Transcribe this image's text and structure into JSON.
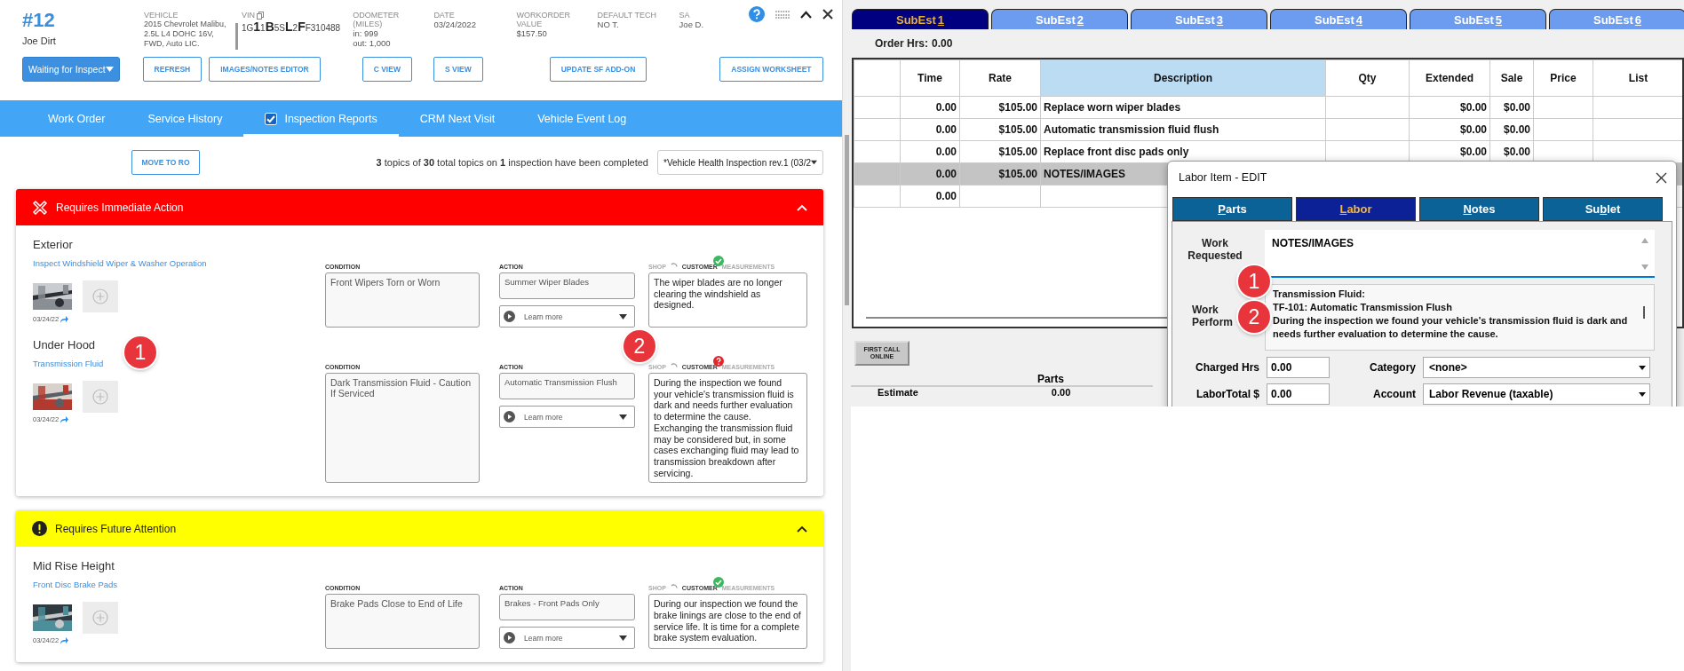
{
  "work_order": {
    "number": "#12",
    "customer": "Joe Dirt",
    "info": [
      {
        "kind": "text",
        "label": "VEHICLE",
        "lines": [
          "2015 Chevrolet Malibu, 2.5L L4 DOHC 16V, FWD, Auto LIC."
        ]
      },
      {
        "kind": "vin",
        "label": "VIN",
        "vin": "1G**1**1**B**5S**L**2**F**F310488"
      },
      {
        "kind": "text",
        "label": "ODOMETER (MILES)",
        "lines": [
          "in: 999",
          "out: 1,000"
        ]
      },
      {
        "kind": "text",
        "label": "DATE",
        "lines": [
          "03/24/2022"
        ]
      },
      {
        "kind": "text",
        "label": "WORKORDER VALUE",
        "lines": [
          "$157.50"
        ]
      },
      {
        "kind": "text",
        "label": "DEFAULT TECH",
        "lines": [
          "NO T."
        ]
      },
      {
        "kind": "text",
        "label": "SA",
        "lines": [
          "Joe D."
        ]
      }
    ],
    "actions": [
      {
        "kind": "status",
        "label": "Waiting for Inspect"
      },
      {
        "kind": "button",
        "label": "REFRESH"
      },
      {
        "kind": "button",
        "label": "IMAGES/NOTES EDITOR"
      },
      {
        "kind": "copy",
        "label": "C VIEW"
      },
      {
        "kind": "copy",
        "label": "S VIEW"
      },
      {
        "kind": "button",
        "label": "UPDATE SF ADD-ON"
      },
      {
        "kind": "button",
        "label": "ASSIGN WORKSHEET"
      }
    ],
    "tabs": [
      {
        "label": "Work Order",
        "selected": false
      },
      {
        "label": "Service History",
        "selected": false
      },
      {
        "label": "Inspection Reports",
        "selected": true,
        "checked": true
      },
      {
        "label": "CRM Next Visit",
        "selected": false
      },
      {
        "label": "Vehicle Event Log",
        "selected": false
      }
    ]
  },
  "inspection": {
    "move_button": "MOVE TO RO",
    "summary": "**3** topics of **30** total topics on **1** inspection have been completed",
    "template": "*Vehicle Health Inspection rev.1 (03/2",
    "sections": [
      {
        "kind": "immediate",
        "title": "Requires Immediate Action",
        "expanded": true,
        "groups": [
          {
            "heading": "Exterior",
            "items": [
              {
                "name": "Inspect Windshield Wiper & Washer Operation",
                "photo_date": "03/24/22",
                "condition_label": "CONDITION",
                "condition": "Front Wipers Torn or Worn",
                "action_label": "ACTION",
                "action": "Summer Wiper Blades",
                "learn_more": "Learn more",
                "shop_label": "SHOP",
                "customer_label": "CUSTOMER",
                "measurements_label": "MEASUREMENTS",
                "customer_approved": true,
                "notes": "The wiper blades are no longer clearing the windshield as designed."
              }
            ]
          },
          {
            "heading": "Under Hood",
            "items": [
              {
                "name": "Transmission Fluid",
                "photo_date": "03/24/22",
                "condition_label": "CONDITION",
                "condition": "Dark Transmission Fluid - Caution If Serviced",
                "action_label": "ACTION",
                "action": "Automatic Transmission Flush",
                "learn_more": "Learn more",
                "shop_label": "SHOP",
                "customer_label": "CUSTOMER",
                "measurements_label": "MEASUREMENTS",
                "customer_approved": false,
                "notes": "During the inspection we found your vehicle's transmission fluid is dark and needs further evaluation to determine the cause. Exchanging the transmission fluid may be considered but, in some cases exchanging fluid may lead to transmission breakdown after servicing."
              }
            ]
          }
        ]
      },
      {
        "kind": "future",
        "title": "Requires Future Attention",
        "expanded": true,
        "groups": [
          {
            "heading": "Mid Rise Height",
            "items": [
              {
                "name": "Front Disc Brake Pads",
                "photo_date": "03/24/22",
                "condition_label": "CONDITION",
                "condition": "Brake Pads Close to End of Life",
                "action_label": "ACTION",
                "action": "Brakes - Front Pads Only",
                "learn_more": "Learn more",
                "shop_label": "SHOP",
                "customer_label": "CUSTOMER",
                "measurements_label": "MEASUREMENTS",
                "customer_approved": true,
                "notes": "During our inspection we found the brake linings are close to the end of service life. It is time for a complete brake system evaluation."
              }
            ]
          }
        ]
      }
    ]
  },
  "estimate": {
    "tabs": [
      {
        "before": "SubEst",
        "key": "1",
        "selected": true
      },
      {
        "before": "SubEst",
        "key": "2",
        "selected": false
      },
      {
        "before": "SubEst",
        "key": "3",
        "selected": false
      },
      {
        "before": "SubEst",
        "key": "4",
        "selected": false
      },
      {
        "before": "SubEst",
        "key": "5",
        "selected": false
      },
      {
        "before": "SubEst",
        "key": "6",
        "selected": false
      }
    ],
    "order_hrs_label": "Order Hrs:",
    "order_hrs": "0.00",
    "columns": [
      {
        "label": "Time",
        "sorted": false
      },
      {
        "label": "Rate",
        "sorted": false
      },
      {
        "label": "Description",
        "sorted": true
      },
      {
        "label": "Qty",
        "sorted": false
      },
      {
        "label": "Extended",
        "sorted": false
      },
      {
        "label": "Sale",
        "sorted": false
      },
      {
        "label": "Price",
        "sorted": false
      },
      {
        "label": "List",
        "sorted": false
      }
    ],
    "rows": [
      {
        "time": "0.00",
        "rate": "$105.00",
        "description": "Replace worn wiper blades",
        "extended": "$0.00",
        "sale": "$0.00",
        "selected": false
      },
      {
        "time": "0.00",
        "rate": "$105.00",
        "description": "Automatic transmission fluid flush",
        "extended": "$0.00",
        "sale": "$0.00",
        "selected": false
      },
      {
        "time": "0.00",
        "rate": "$105.00",
        "description": "Replace front disc pads only",
        "extended": "$0.00",
        "sale": "$0.00",
        "selected": false
      },
      {
        "time": "0.00",
        "rate": "$105.00",
        "description": "NOTES/IMAGES",
        "selected": true
      },
      {
        "time": "0.00",
        "selected": false
      }
    ],
    "first_call": "FIRST CALL ONLINE",
    "parts_heading": "Parts",
    "estimate_label": "Estimate",
    "estimate_value": "0.00"
  },
  "dialog": {
    "title": "Labor Item - EDIT",
    "tabs": [
      {
        "key": "P",
        "after": "arts",
        "selected": false
      },
      {
        "key": "L",
        "after": "abor",
        "selected": true
      },
      {
        "key": "N",
        "after": "otes",
        "selected": false
      },
      {
        "before": "Su",
        "key": "b",
        "after": "let",
        "selected": false
      }
    ],
    "work_requested_label": "Work Requested",
    "work_requested": "NOTES/IMAGES",
    "work_performed_label": "Work Perform",
    "work_performed": [
      "Transmission Fluid:",
      "TF-101: Automatic Transmission Flush",
      "During the inspection we found your vehicle's transmission fluid is dark and needs further evaluation to determine the cause."
    ],
    "charged_hrs_label": "Charged Hrs",
    "charged_hrs": "0.00",
    "category_label": "Category",
    "category": "<none>",
    "labor_total_label": "LaborTotal $",
    "labor_total": "0.00",
    "account_label": "Account",
    "account": "Labor Revenue (taxable)"
  },
  "callouts": [
    {
      "label": "1"
    },
    {
      "label": "2"
    },
    {
      "label": "1"
    },
    {
      "label": "2"
    }
  ]
}
